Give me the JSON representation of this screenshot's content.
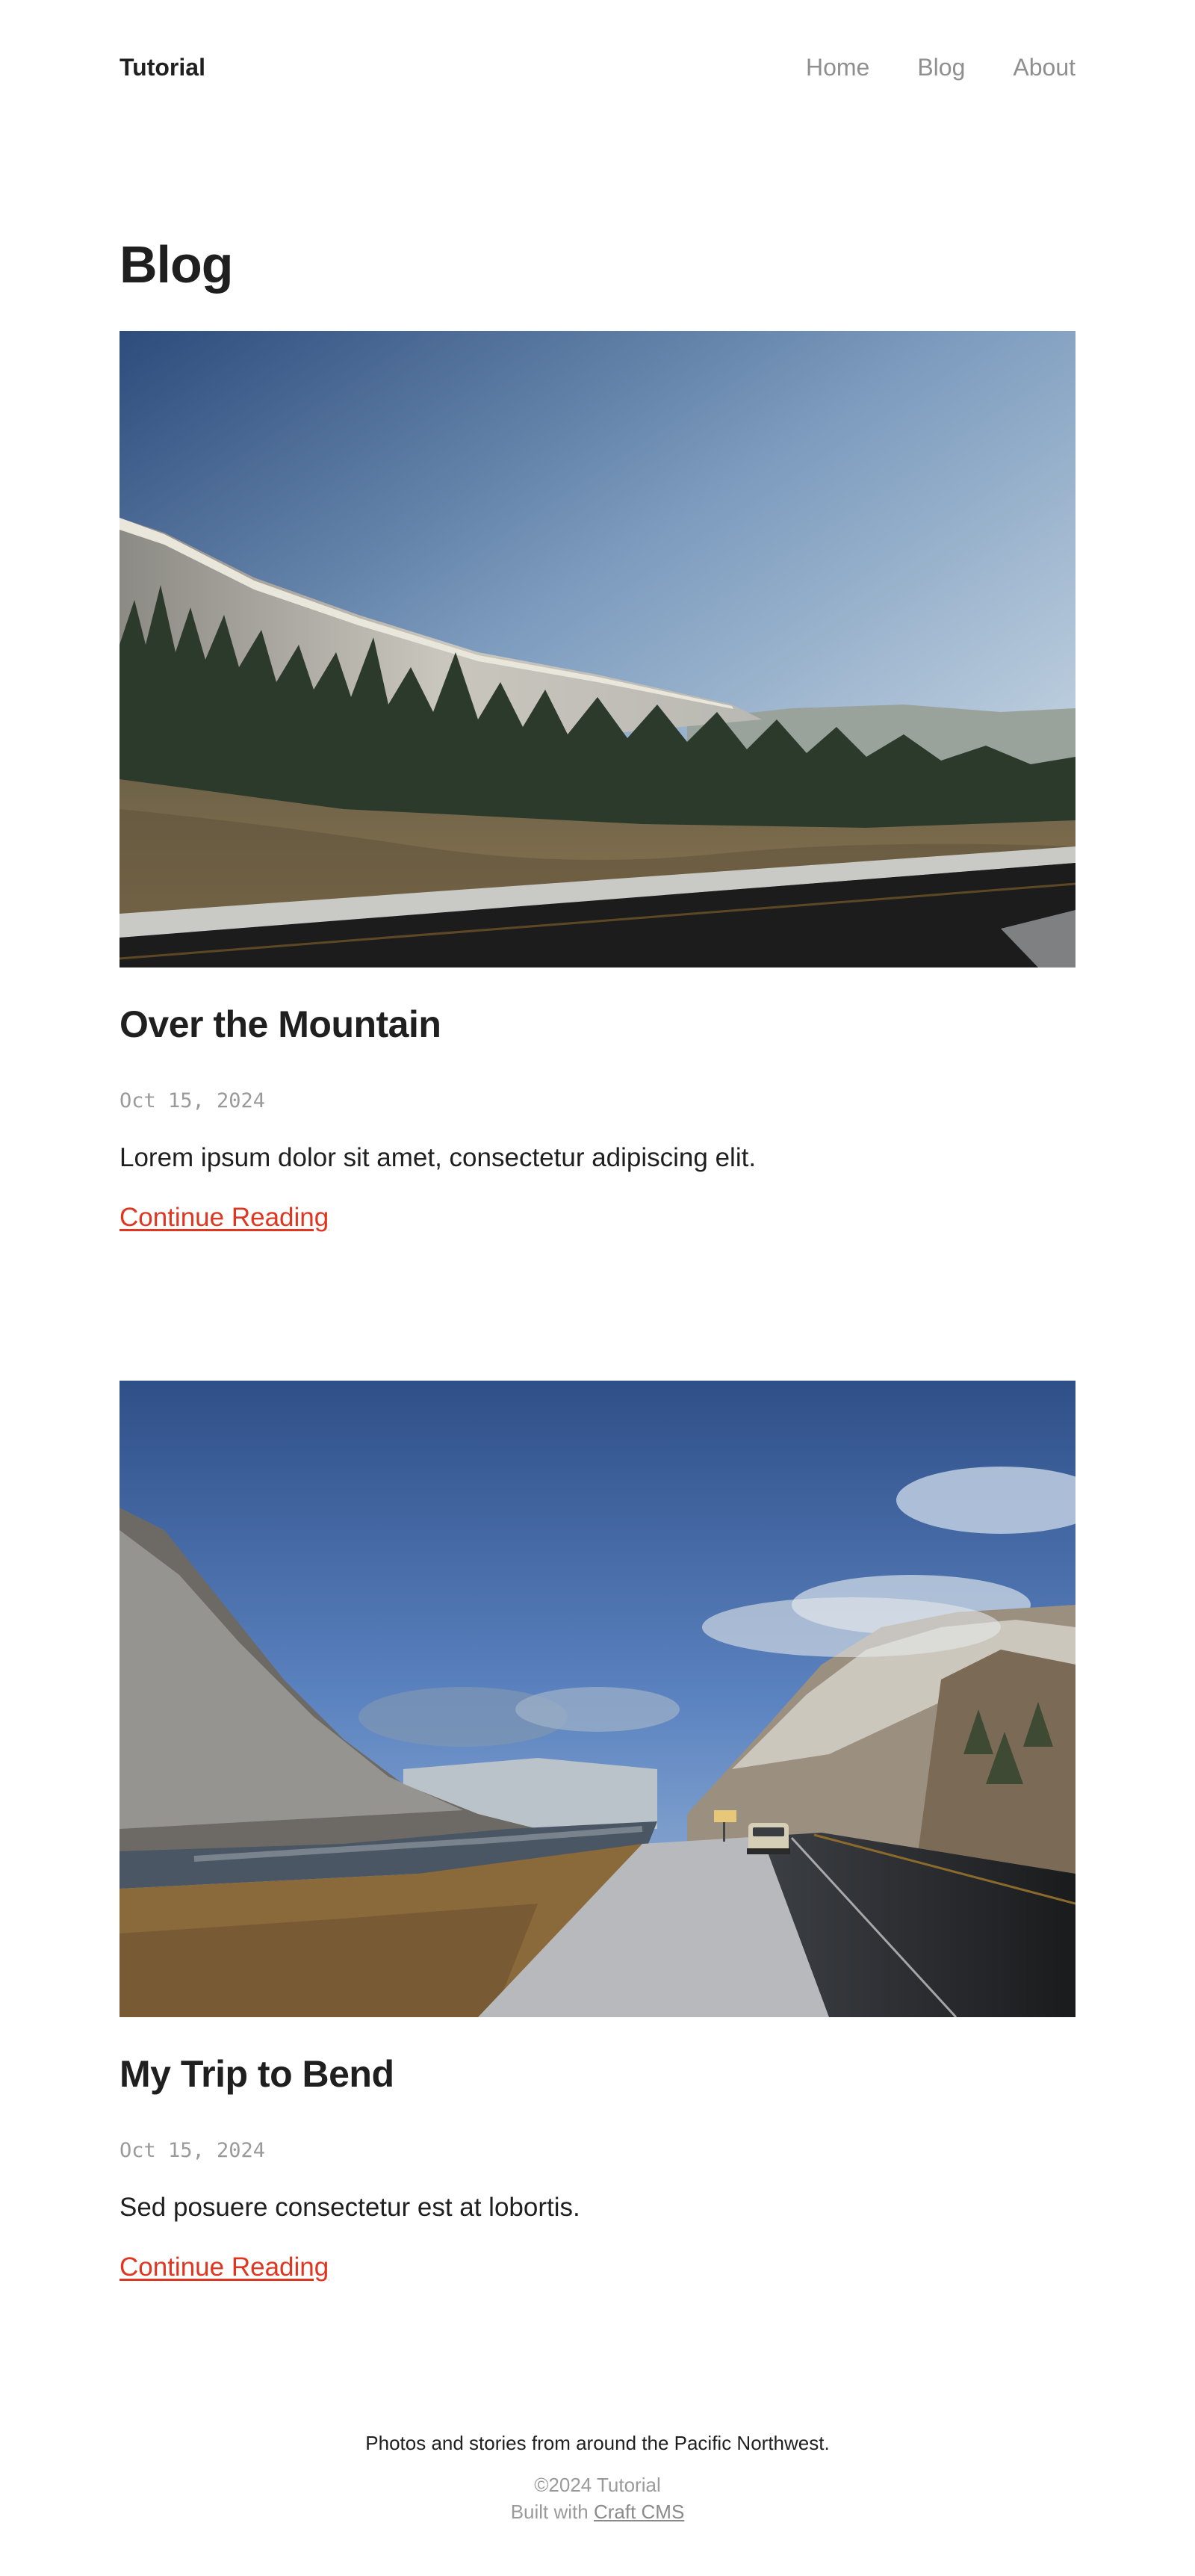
{
  "header": {
    "logo": "Tutorial",
    "nav": [
      {
        "label": "Home"
      },
      {
        "label": "Blog"
      },
      {
        "label": "About"
      }
    ]
  },
  "page": {
    "title": "Blog"
  },
  "posts": [
    {
      "image": "mountain-road-photo",
      "title": "Over the Mountain",
      "date": "Oct 15, 2024",
      "excerpt": "Lorem ipsum dolor sit amet, consectetur adipiscing elit.",
      "link_label": "Continue Reading"
    },
    {
      "image": "river-valley-van-photo",
      "title": "My Trip to Bend",
      "date": "Oct 15, 2024",
      "excerpt": "Sed posuere consectetur est at lobortis.",
      "link_label": "Continue Reading"
    }
  ],
  "footer": {
    "tagline": "Photos and stories from around the Pacific Northwest.",
    "copyright": "©2024 Tutorial",
    "built_with_prefix": "Built with",
    "built_with_link": "Craft CMS"
  },
  "colors": {
    "text": "#1f1f1f",
    "muted": "#8f8f8f",
    "accent": "#e0361f",
    "background": "#ffffff"
  }
}
